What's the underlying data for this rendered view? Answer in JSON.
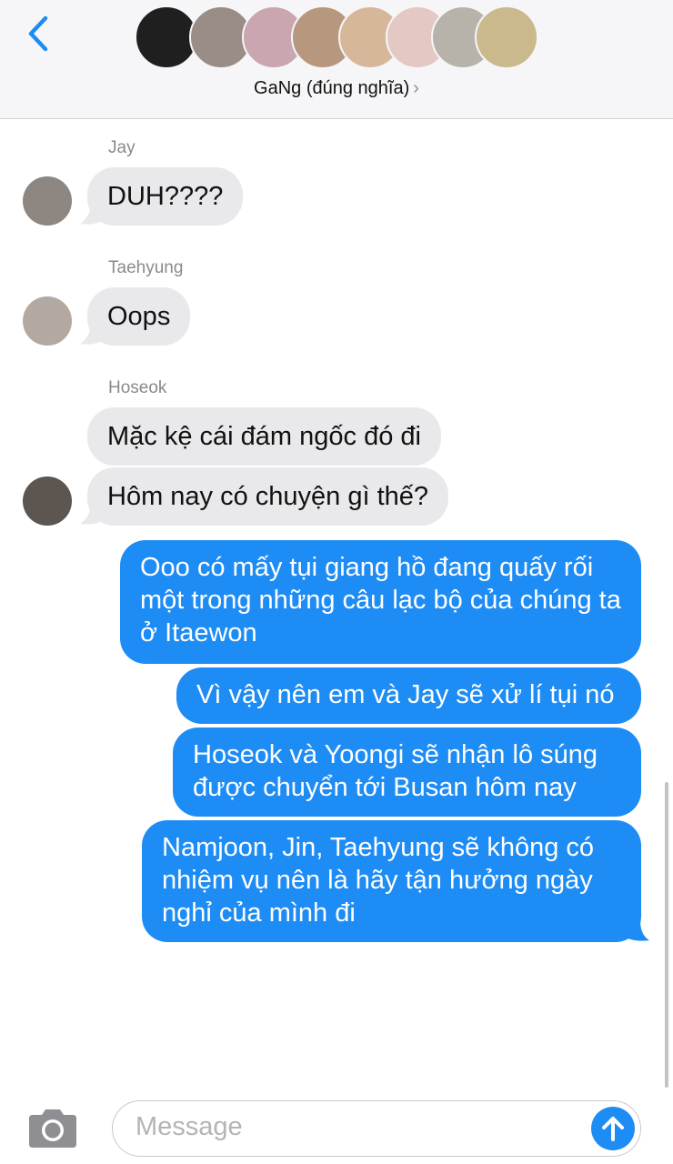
{
  "header": {
    "group_name": "GaNg (đúng nghĩa)",
    "chevron": "›",
    "avatar_colors": [
      "#1f1f1f",
      "#9a8d86",
      "#c9a6b0",
      "#b7987f",
      "#d7b79a",
      "#e4c8c4",
      "#b8b3aa",
      "#c9b98c"
    ]
  },
  "messages": {
    "incoming": [
      {
        "sender": "Jay",
        "text": "DUH????"
      },
      {
        "sender": "Taehyung",
        "text": "Oops"
      },
      {
        "sender": "Hoseok",
        "text": "Mặc kệ cái đám ngốc đó đi"
      },
      {
        "sender": "",
        "text": "Hôm nay có chuyện gì thế?"
      }
    ],
    "outgoing": [
      {
        "text": "Ooo có mấy tụi giang hồ đang quấy rối một trong những câu lạc bộ của chúng ta ở Itaewon"
      },
      {
        "text": "Vì vậy nên em và Jay sẽ xử lí tụi nó"
      },
      {
        "text": "Hoseok và Yoongi sẽ nhận lô súng được chuyển tới Busan hôm nay"
      },
      {
        "text": "Namjoon, Jin, Taehyung sẽ không có nhiệm vụ nên là hãy tận hưởng ngày nghỉ của mình đi"
      }
    ]
  },
  "composer": {
    "placeholder": "Message"
  },
  "colors": {
    "accent": "#1e8cf5",
    "incoming_bubble": "#e9e9eb",
    "header_bg": "#f6f6f8"
  },
  "icons": {
    "back": "chevron-left-icon",
    "camera": "camera-icon",
    "send": "arrow-up-icon"
  }
}
